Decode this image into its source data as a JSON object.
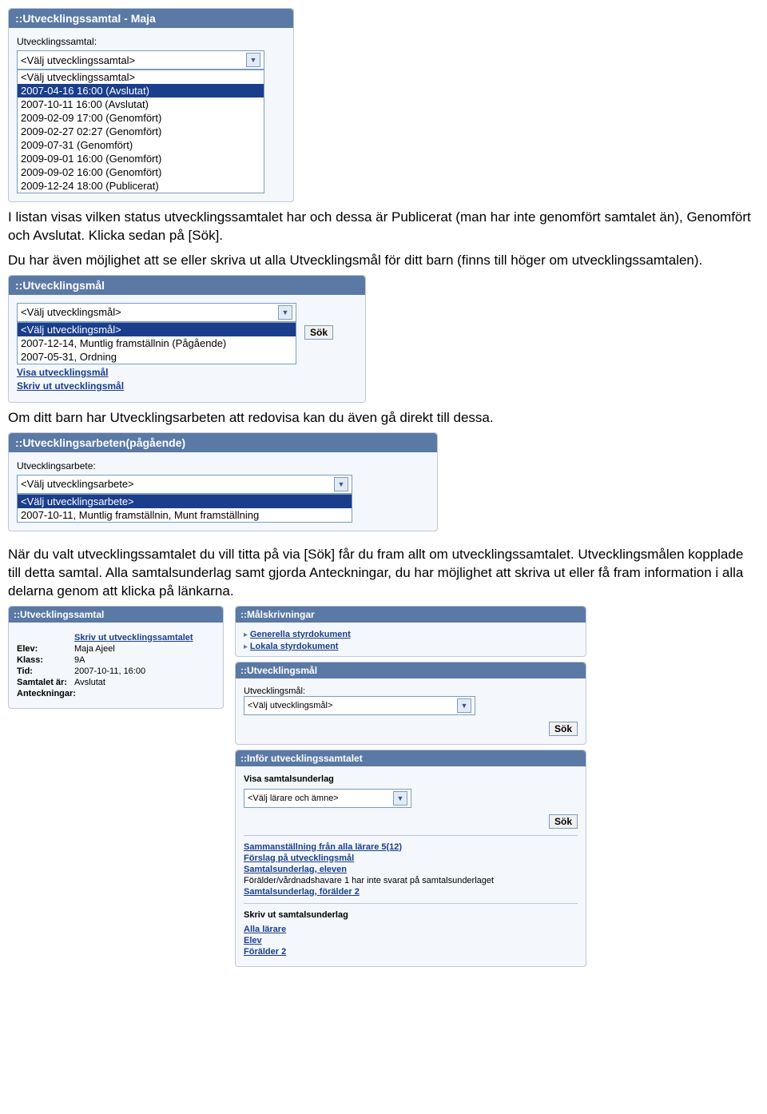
{
  "panel1": {
    "title": "::Utvecklingssamtal - Maja",
    "label": "Utvecklingssamtal:",
    "selected": "<Välj utvecklingssamtal>",
    "options": [
      "<Välj utvecklingssamtal>",
      "2007-04-16 16:00 (Avslutat)",
      "2007-10-11 16:00 (Avslutat)",
      "2009-02-09 17:00 (Genomfört)",
      "2009-02-27 02:27 (Genomfört)",
      "2009-07-31 (Genomfört)",
      "2009-09-01 16:00 (Genomfört)",
      "2009-09-02 16:00 (Genomfört)",
      "2009-12-24 18:00 (Publicerat)"
    ]
  },
  "para1": "I listan visas vilken status utvecklingssamtalet har och dessa är Publicerat (man har inte genomfört samtalet än), Genomfört och Avslutat. Klicka sedan på [Sök].",
  "para2": "Du har även möjlighet att se eller skriva ut alla Utvecklingsmål för ditt barn (finns till höger om utvecklingssamtalen).",
  "panel2": {
    "title": "::Utvecklingsmål",
    "selected": "<Välj utvecklingsmål>",
    "options": [
      "<Välj utvecklingsmål>",
      "2007-12-14, Muntlig framställnin (Pågående)",
      "2007-05-31, Ordning"
    ],
    "btn": "Sök",
    "link1": "Visa utvecklingsmål",
    "link2": "Skriv ut utvecklingsmål"
  },
  "para3": "Om ditt barn har Utvecklingsarbeten att redovisa kan du även gå direkt till dessa.",
  "panel3": {
    "title": "::Utvecklingsarbeten(pågående)",
    "label": "Utvecklingsarbete:",
    "selected": "<Välj utvecklingsarbete>",
    "options": [
      "<Välj utvecklingsarbete>",
      "2007-10-11, Muntlig framställnin, Munt framställning"
    ]
  },
  "para4": "När du valt utvecklingssamtalet du vill titta på via [Sök] får du fram allt om utvecklingssamtalet. Utvecklingsmålen kopplade till detta samtal. Alla samtalsunderlag samt gjorda Anteckningar, du har möjlighet att skriva ut eller få fram information i alla delarna genom att klicka på länkarna.",
  "detail": {
    "left": {
      "title": "::Utvecklingssamtal",
      "printLink": "Skriv ut utvecklingssamtalet",
      "rows": {
        "elev_k": "Elev:",
        "elev_v": "Maja Ajeel",
        "klass_k": "Klass:",
        "klass_v": "9A",
        "tid_k": "Tid:",
        "tid_v": "2007-10-11, 16:00",
        "status_k": "Samtalet är:",
        "status_v": "Avslutat",
        "ant_k": "Anteckningar:"
      }
    },
    "right": {
      "malskr": {
        "title": "::Målskrivningar",
        "l1": "Generella styrdokument",
        "l2": "Lokala styrdokument"
      },
      "utvmal": {
        "title": "::Utvecklingsmål",
        "label": "Utvecklingsmål:",
        "selected": "<Välj utvecklingsmål>",
        "btn": "Sök"
      },
      "infor": {
        "title": "::Inför utvecklingssamtalet",
        "section1": "Visa samtalsunderlag",
        "selected": "<Välj lärare och ämne>",
        "btn": "Sök",
        "links": {
          "l1": "Sammanställning från alla lärare 5(12)",
          "l2": "Förslag på utvecklingsmål",
          "l3": "Samtalsunderlag, eleven",
          "note": "Förälder/vårdnadshavare 1 har inte svarat på samtalsunderlaget",
          "l4": "Samtalsunderlag, förälder 2"
        },
        "section2": "Skriv ut samtalsunderlag",
        "links2": {
          "l1": "Alla lärare",
          "l2": "Elev",
          "l3": "Förälder 2"
        }
      }
    }
  }
}
